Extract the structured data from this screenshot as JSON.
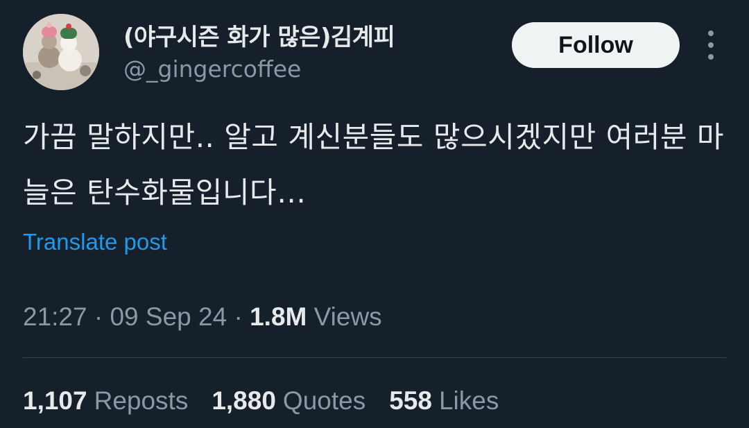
{
  "author": {
    "display_name": "(야구시즌 화가 많은)김계피",
    "handle": "@_gingercoffee"
  },
  "follow_button": {
    "label": "Follow"
  },
  "more_menu": {
    "icon": "more-vertical-icon"
  },
  "post": {
    "text": "가끔 말하지만.. 알고 계신분들도 많으시겠지만 여러분 마늘은 탄수화물입니다…",
    "translate_label": "Translate post",
    "time": "21:27",
    "separator": "·",
    "date": "09 Sep 24",
    "views_count": "1.8M",
    "views_label": "Views"
  },
  "stats": [
    {
      "count": "1,107",
      "label": "Reposts"
    },
    {
      "count": "1,880",
      "label": "Quotes"
    },
    {
      "count": "558",
      "label": "Likes"
    }
  ],
  "colors": {
    "background": "#15202b",
    "text_primary": "#e7e9ea",
    "text_secondary": "#8b98a5",
    "link": "#1d9bf0",
    "follow_bg": "#eff3f4"
  }
}
